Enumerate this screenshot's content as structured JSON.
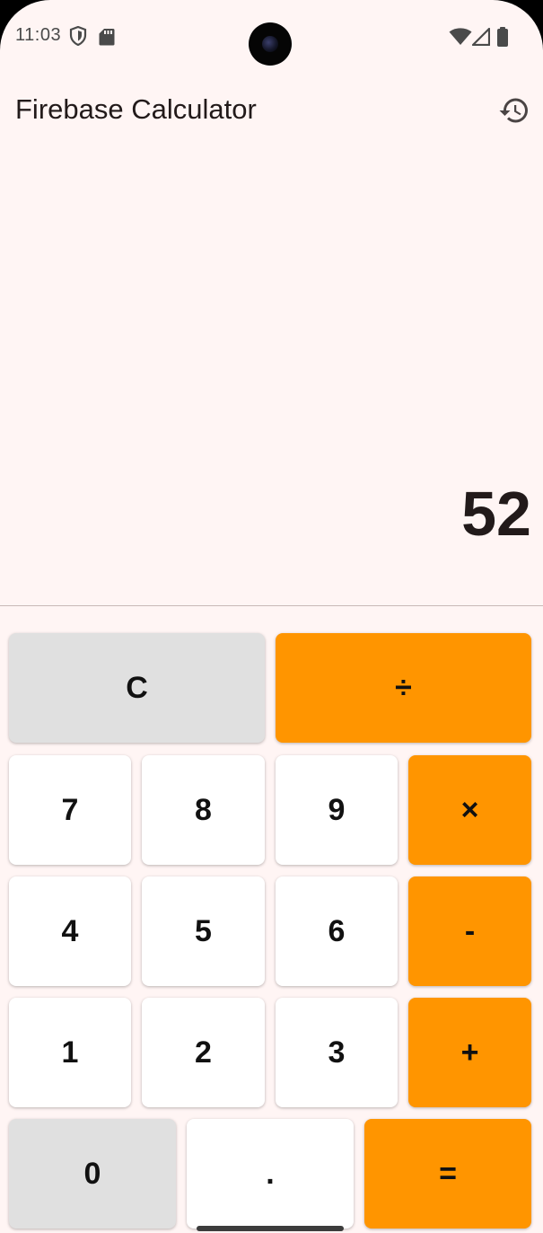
{
  "status_bar": {
    "time": "11:03",
    "left_icons": [
      "shield-icon",
      "sd-card-icon"
    ],
    "right_icons": [
      "wifi-icon",
      "cellular-signal-icon",
      "battery-icon"
    ]
  },
  "app_bar": {
    "title": "Firebase Calculator",
    "history_icon": "history-icon"
  },
  "display": {
    "value": "52"
  },
  "keypad": {
    "clear": "C",
    "divide": "÷",
    "seven": "7",
    "eight": "8",
    "nine": "9",
    "multiply": "×",
    "four": "4",
    "five": "5",
    "six": "6",
    "subtract": "-",
    "one": "1",
    "two": "2",
    "three": "3",
    "add": "+",
    "zero": "0",
    "decimal": ".",
    "equals": "="
  },
  "colors": {
    "background": "#fff5f4",
    "operator": "#ff9500",
    "function_key": "#e0e0e0",
    "number_key": "#ffffff",
    "text": "#221a1a"
  }
}
